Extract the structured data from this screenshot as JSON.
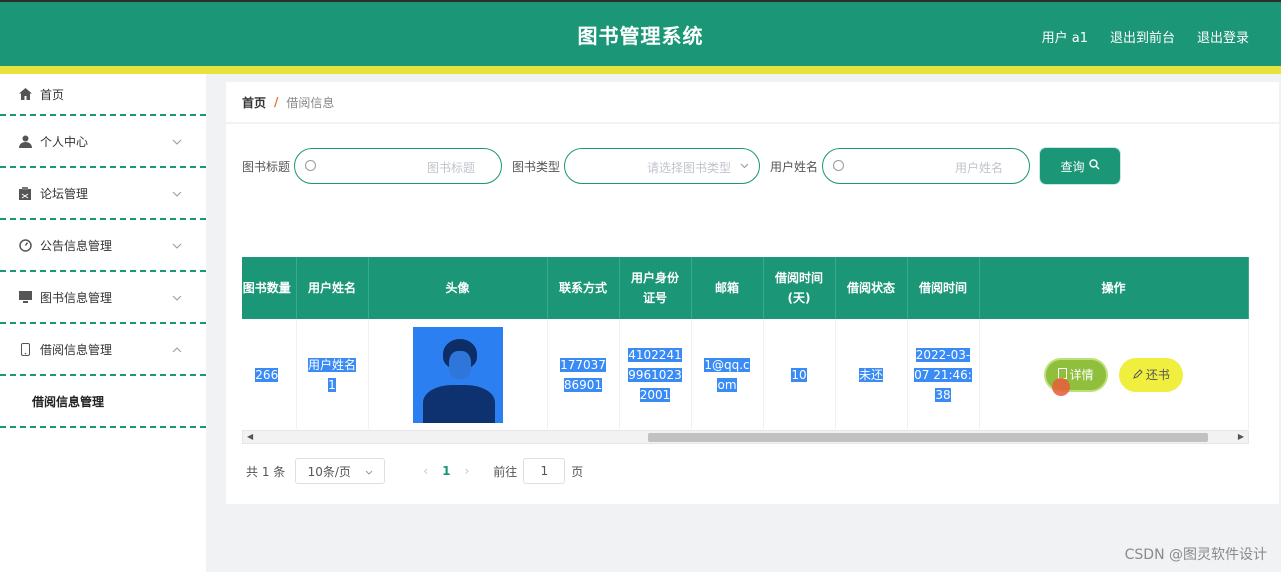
{
  "header": {
    "title": "图书管理系统",
    "user": "用户 a1",
    "to_front": "退出到前台",
    "logout": "退出登录"
  },
  "sidebar": {
    "items": [
      {
        "label": "首页"
      },
      {
        "label": "个人中心"
      },
      {
        "label": "论坛管理"
      },
      {
        "label": "公告信息管理"
      },
      {
        "label": "图书信息管理"
      },
      {
        "label": "借阅信息管理"
      }
    ],
    "sub_item": "借阅信息管理"
  },
  "breadcrumb": {
    "home": "首页",
    "sep": "/",
    "current": "借阅信息"
  },
  "search": {
    "title_label": "图书标题",
    "title_placeholder": "图书标题",
    "type_label": "图书类型",
    "type_placeholder": "请选择图书类型",
    "name_label": "用户姓名",
    "name_placeholder": "用户姓名",
    "query_btn": "查询"
  },
  "table": {
    "headers": [
      "图书数量",
      "用户姓名",
      "头像",
      "联系方式",
      "用户身份证号",
      "邮箱",
      "借阅时间(天)",
      "借阅状态",
      "借阅时间",
      "操作"
    ],
    "row": {
      "count": "266",
      "name": "用户姓名1",
      "phone": "17703786901",
      "idcard": "410224199610232001",
      "email": "1@qq.com",
      "days": "10",
      "status": "未还",
      "time": "2022-03-07 21:46:38"
    },
    "detail_btn": "详情",
    "return_btn": "还书"
  },
  "pager": {
    "total": "共 1 条",
    "size": "10条/页",
    "page": "1",
    "goto": "前往",
    "goto_val": "1",
    "page_unit": "页"
  },
  "watermark": "CSDN @图灵软件设计"
}
